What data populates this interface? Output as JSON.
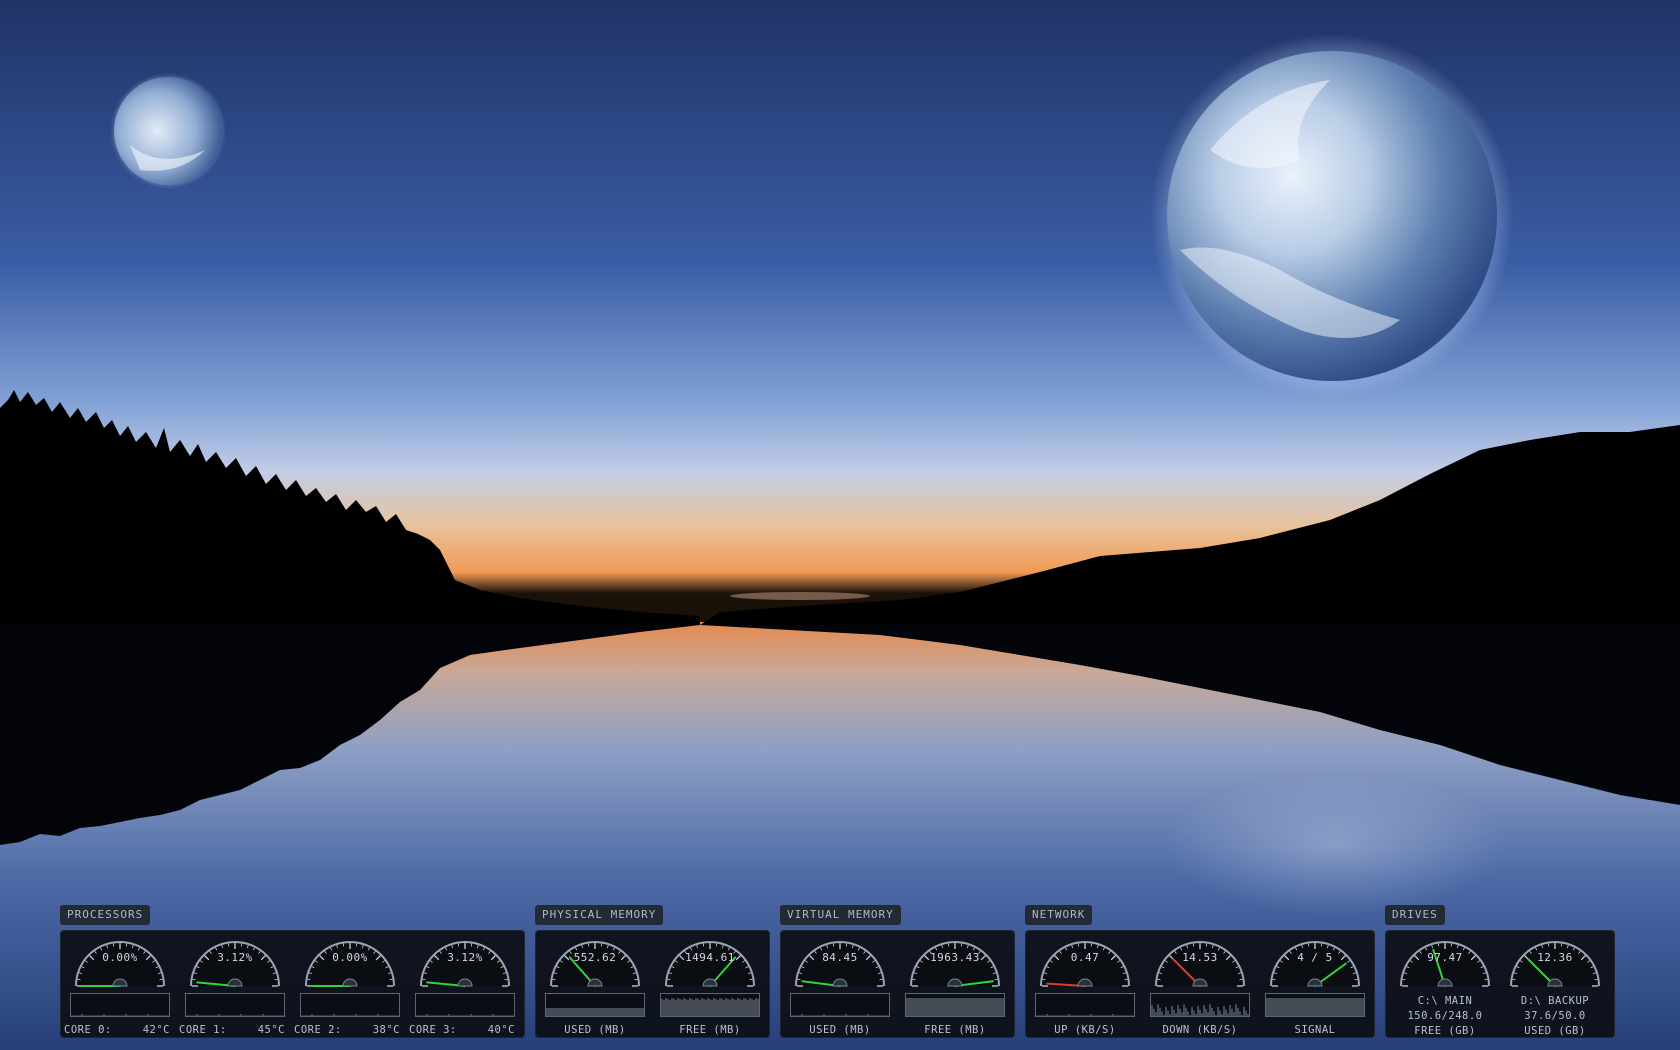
{
  "colors": {
    "needle_green": "#33d43a",
    "needle_red": "#e23a2a",
    "sky_top": "#22386f",
    "horizon": "#f0a25e"
  },
  "panels": {
    "processors": {
      "title": "PROCESSORS",
      "cores": [
        {
          "value": "0.00%",
          "label": "CORE 0:",
          "temp": "42°C",
          "level": 0.0
        },
        {
          "value": "3.12%",
          "label": "CORE 1:",
          "temp": "45°C",
          "level": 0.03
        },
        {
          "value": "0.00%",
          "label": "CORE 2:",
          "temp": "38°C",
          "level": 0.0
        },
        {
          "value": "3.12%",
          "label": "CORE 3:",
          "temp": "40°C",
          "level": 0.03
        }
      ]
    },
    "physical_memory": {
      "title": "PHYSICAL MEMORY",
      "used": {
        "value": "552.62",
        "label": "USED (MB)",
        "level": 0.27
      },
      "free": {
        "value": "1494.61",
        "label": "FREE (MB)",
        "level": 0.73
      }
    },
    "virtual_memory": {
      "title": "VIRTUAL MEMORY",
      "used": {
        "value": "84.45",
        "label": "USED (MB)",
        "level": 0.04
      },
      "free": {
        "value": "1963.43",
        "label": "FREE (MB)",
        "level": 0.96
      }
    },
    "network": {
      "title": "NETWORK",
      "up": {
        "value": "0.47",
        "label": "UP (KB/S)",
        "level": 0.02
      },
      "down": {
        "value": "14.53",
        "label": "DOWN (KB/S)",
        "level": 0.25
      },
      "signal": {
        "value": "4 / 5",
        "label": "SIGNAL",
        "level": 0.8
      }
    },
    "drives": {
      "title": "DRIVES",
      "c": {
        "value": "97.47",
        "name": "C:\\ MAIN",
        "size": "150.6/248.0",
        "label": "FREE (GB)",
        "level": 0.4
      },
      "d": {
        "value": "12.36",
        "name": "D:\\ BACKUP",
        "size": "37.6/50.0",
        "label": "USED (GB)",
        "level": 0.25
      }
    }
  }
}
